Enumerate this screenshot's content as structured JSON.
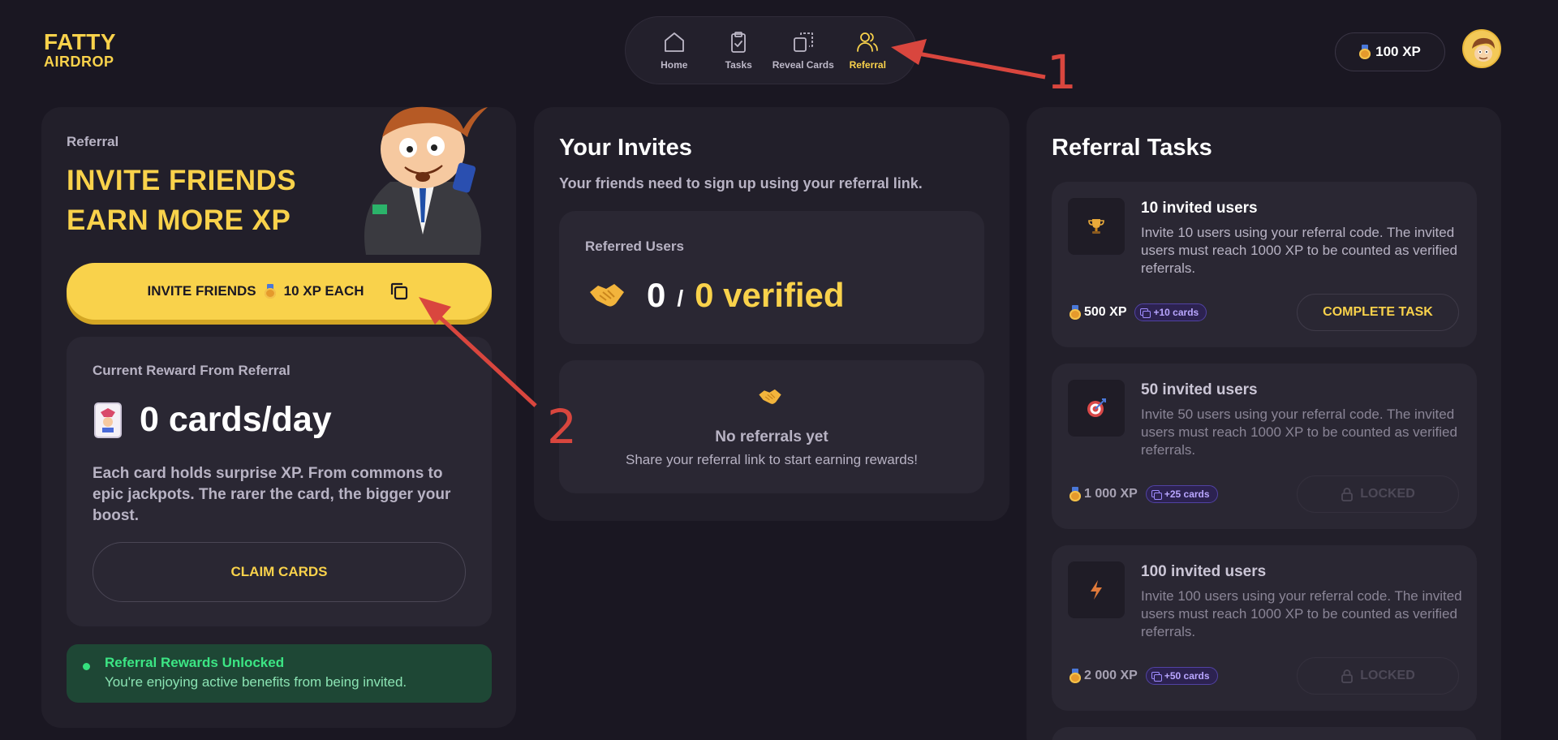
{
  "brand": {
    "line1": "FATTY",
    "line2": "AIRDROP"
  },
  "nav": {
    "items": [
      {
        "label": "Home",
        "icon": "home-icon",
        "active": false
      },
      {
        "label": "Tasks",
        "icon": "clipboard-check-icon",
        "active": false
      },
      {
        "label": "Reveal Cards",
        "icon": "reveal-cards-icon",
        "active": false
      },
      {
        "label": "Referral",
        "icon": "users-icon",
        "active": true
      }
    ]
  },
  "header": {
    "xp": "100 XP"
  },
  "annotations": {
    "one": "1",
    "two": "2"
  },
  "referral_panel": {
    "section_label": "Referral",
    "hero_line1": "INVITE FRIENDS",
    "hero_line2": "EARN MORE XP",
    "invite_prefix": "INVITE FRIENDS",
    "invite_suffix": "10 XP EACH",
    "reward_label": "Current Reward From Referral",
    "reward_amount": "0 cards/day",
    "reward_desc": "Each card holds surprise XP. From commons to epic jackpots. The rarer the card, the bigger your boost.",
    "claim_label": "CLAIM CARDS",
    "unlock_title": "Referral Rewards Unlocked",
    "unlock_sub": "You're enjoying active benefits from being invited."
  },
  "invites_panel": {
    "title": "Your Invites",
    "subtitle": "Your friends need to sign up using your referral link.",
    "referred_label": "Referred Users",
    "referred_count": "0",
    "slash": "/",
    "verified_text": "0 verified",
    "empty_title": "No referrals yet",
    "empty_sub": "Share your referral link to start earning rewards!"
  },
  "tasks_panel": {
    "title": "Referral Tasks",
    "tasks": [
      {
        "icon": "trophy-icon",
        "title": "10 invited users",
        "desc": "Invite 10 users using your referral code. The invited users must reach 1000 XP to be counted as verified referrals.",
        "xp": "500 XP",
        "cards": "+10 cards",
        "action": "COMPLETE TASK",
        "locked": false
      },
      {
        "icon": "target-icon",
        "title": "50 invited users",
        "desc": "Invite 50 users using your referral code. The invited users must reach 1000 XP to be counted as verified referrals.",
        "xp": "1 000 XP",
        "cards": "+25 cards",
        "action": "LOCKED",
        "locked": true
      },
      {
        "icon": "lightning-icon",
        "title": "100 invited users",
        "desc": "Invite 100 users using your referral code. The invited users must reach 1000 XP to be counted as verified referrals.",
        "xp": "2 000 XP",
        "cards": "+50 cards",
        "action": "LOCKED",
        "locked": true
      }
    ]
  },
  "colors": {
    "accent": "#f9d24b",
    "background": "#1a1722",
    "panel": "#221f2a",
    "card": "#2a2733",
    "success": "#3ce684",
    "annotation": "#d9463e"
  }
}
